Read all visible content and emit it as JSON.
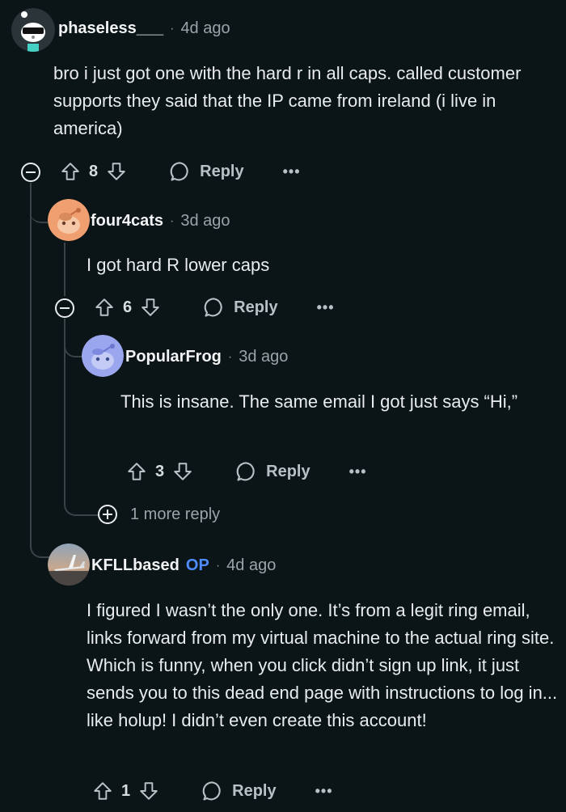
{
  "comments": [
    {
      "username": "phaseless___",
      "time": "4d ago",
      "body": "bro i just got one with the hard r in all caps. called customer supports they said that the IP came from ireland (i live in america)",
      "votes": "8",
      "reply_label": "Reply",
      "more_label": "•••"
    },
    {
      "username": "four4cats",
      "time": "3d ago",
      "body": "I got hard R lower caps",
      "votes": "6",
      "reply_label": "Reply",
      "more_label": "•••"
    },
    {
      "username": "PopularFrog",
      "time": "3d ago",
      "body": "This is insane. The same email I got just says “Hi,”",
      "votes": "3",
      "reply_label": "Reply",
      "more_label": "•••",
      "more_replies": "1 more reply"
    },
    {
      "username": "KFLLbased",
      "op_badge": "OP",
      "time": "4d ago",
      "body": "I figured I wasn’t the only one. It’s from a legit ring email, links forward from my virtual machine to the actual ring site. Which is funny, when you click didn’t sign up link, it just sends you to this dead end page with instructions to log in... like holup! I didn’t even create this account!",
      "votes": "1",
      "reply_label": "Reply",
      "more_label": "•••"
    }
  ],
  "separator": "·"
}
